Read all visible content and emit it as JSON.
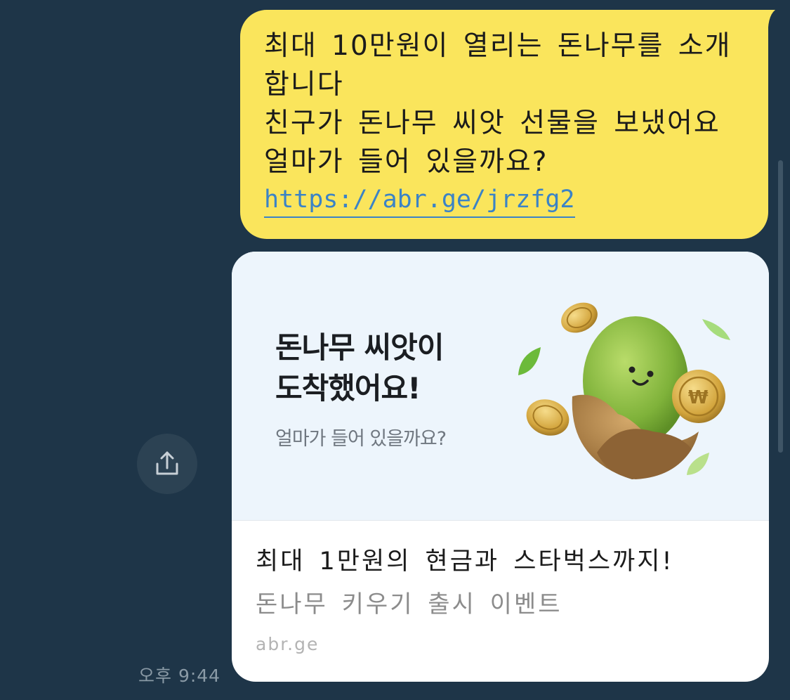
{
  "message": {
    "lines": [
      "최대 10만원이 열리는 돈나무를 소개",
      "합니다",
      "친구가 돈나무 씨앗 선물을 보냈어요",
      "얼마가 들어 있을까요?"
    ],
    "link": "https://abr.ge/jrzfg2"
  },
  "preview": {
    "image_headline_line1": "돈나무 씨앗이",
    "image_headline_line2": "도착했어요!",
    "image_subtext": "얼마가 들어 있을까요?",
    "title": "최대 1만원의 현금과 스타벅스까지!",
    "description": "돈나무 키우기 출시 이벤트",
    "domain": "abr.ge"
  },
  "timestamp": "오후 9:44",
  "icons": {
    "share": "share-icon",
    "illustration": "money-seed-illustration"
  },
  "colors": {
    "background": "#1e3548",
    "bubble": "#fae55c",
    "link": "#3b83c6",
    "card_image_bg": "#edf5fc"
  }
}
